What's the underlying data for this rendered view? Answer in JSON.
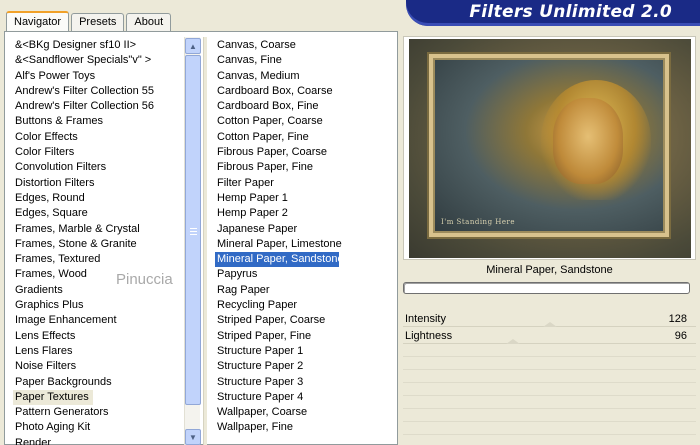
{
  "tabs": [
    {
      "label": "Navigator",
      "active": true
    },
    {
      "label": "Presets",
      "active": false
    },
    {
      "label": "About",
      "active": false
    }
  ],
  "app_title": "Filters Unlimited 2.0",
  "categories": [
    "&<BKg Designer sf10 II>",
    "&<Sandflower Specials\"v\" >",
    "Alf's Power Toys",
    "Andrew's Filter Collection 55",
    "Andrew's Filter Collection 56",
    "Buttons & Frames",
    "Color Effects",
    "Color Filters",
    "Convolution Filters",
    "Distortion Filters",
    "Edges, Round",
    "Edges, Square",
    "Frames, Marble & Crystal",
    "Frames, Stone & Granite",
    "Frames, Textured",
    "Frames, Wood",
    "Gradients",
    "Graphics Plus",
    "Image Enhancement",
    "Lens Effects",
    "Lens Flares",
    "Noise Filters",
    "Paper Backgrounds",
    "Paper Textures",
    "Pattern Generators",
    "Photo Aging Kit",
    "Render"
  ],
  "selected_category": "Paper Textures",
  "filters": [
    "Canvas, Coarse",
    "Canvas, Fine",
    "Canvas, Medium",
    "Cardboard Box, Coarse",
    "Cardboard Box, Fine",
    "Cotton Paper, Coarse",
    "Cotton Paper, Fine",
    "Fibrous Paper, Coarse",
    "Fibrous Paper, Fine",
    "Filter Paper",
    "Hemp Paper 1",
    "Hemp Paper 2",
    "Japanese Paper",
    "Mineral Paper, Limestone",
    "Mineral Paper, Sandstone",
    "Papyrus",
    "Rag Paper",
    "Recycling Paper",
    "Striped Paper, Coarse",
    "Striped Paper, Fine",
    "Structure Paper 1",
    "Structure Paper 2",
    "Structure Paper 3",
    "Structure Paper 4",
    "Wallpaper, Coarse",
    "Wallpaper, Fine"
  ],
  "selected_filter": "Mineral Paper, Sandstone",
  "watermark_text": "Pinuccia",
  "preview": {
    "image_mark": "I'm Standing Here"
  },
  "current_filter_label": "Mineral Paper, Sandstone",
  "parameters": [
    {
      "label": "Intensity",
      "value": "128",
      "level": 0.5
    },
    {
      "label": "Lightness",
      "value": "96",
      "level": 0.376
    }
  ],
  "icons": {
    "scroll_up": "arrow-up-icon",
    "scroll_down": "arrow-down-icon"
  }
}
